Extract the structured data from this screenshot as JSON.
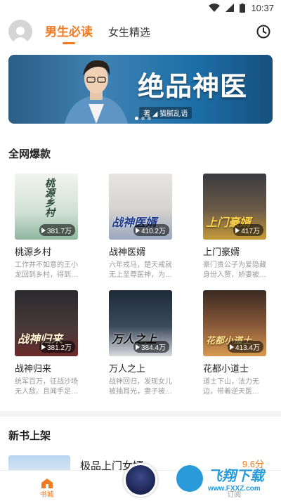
{
  "status_bar": {
    "time": "10:37"
  },
  "header": {
    "tabs": [
      {
        "label": "男生必读",
        "active": true
      },
      {
        "label": "女生精选",
        "active": false
      }
    ]
  },
  "banner": {
    "title": "绝品神医",
    "author": "著 ◢ 猫腻乱语"
  },
  "section_hot": {
    "title": "全网爆款",
    "books": [
      {
        "name": "桃源乡村",
        "plays": "381.7万",
        "cover_text": "桃源乡村",
        "desc": "工作并不如意的王小龙回到乡村，得到…"
      },
      {
        "name": "战神医婿",
        "plays": "410.2万",
        "cover_text": "战神医婿",
        "desc": "六年戎马，楚天戒就无上至尊医神，为…"
      },
      {
        "name": "上门豪婿",
        "plays": "417万",
        "cover_text": "上门豪婿",
        "desc": "豪门贵公子为爱隐藏身份入赘，娇妻被…"
      },
      {
        "name": "战神归来",
        "plays": "381.2万",
        "cover_text": "战神归来",
        "desc": "统军百万，征战沙场无人敌。且闻手足…"
      },
      {
        "name": "万人之上",
        "plays": "384.4万",
        "cover_text": "万人之上",
        "desc": "战神回归，发现女儿被抽耳光，妻子被…"
      },
      {
        "name": "花都小道士",
        "plays": "413.4万",
        "cover_text": "花都小道士",
        "desc": "道士下山，法力无边，带着逆天医…"
      }
    ]
  },
  "section_new": {
    "title": "新书上架",
    "first_book": {
      "name": "极品上门女婿",
      "score": "9.6分"
    }
  },
  "tabbar": {
    "home_label": "书城",
    "subscribe_label": "订阅"
  },
  "watermark": {
    "title": "飞翔下载",
    "url": "www.FXXZ.com"
  },
  "colors": {
    "accent": "#f07a22"
  }
}
